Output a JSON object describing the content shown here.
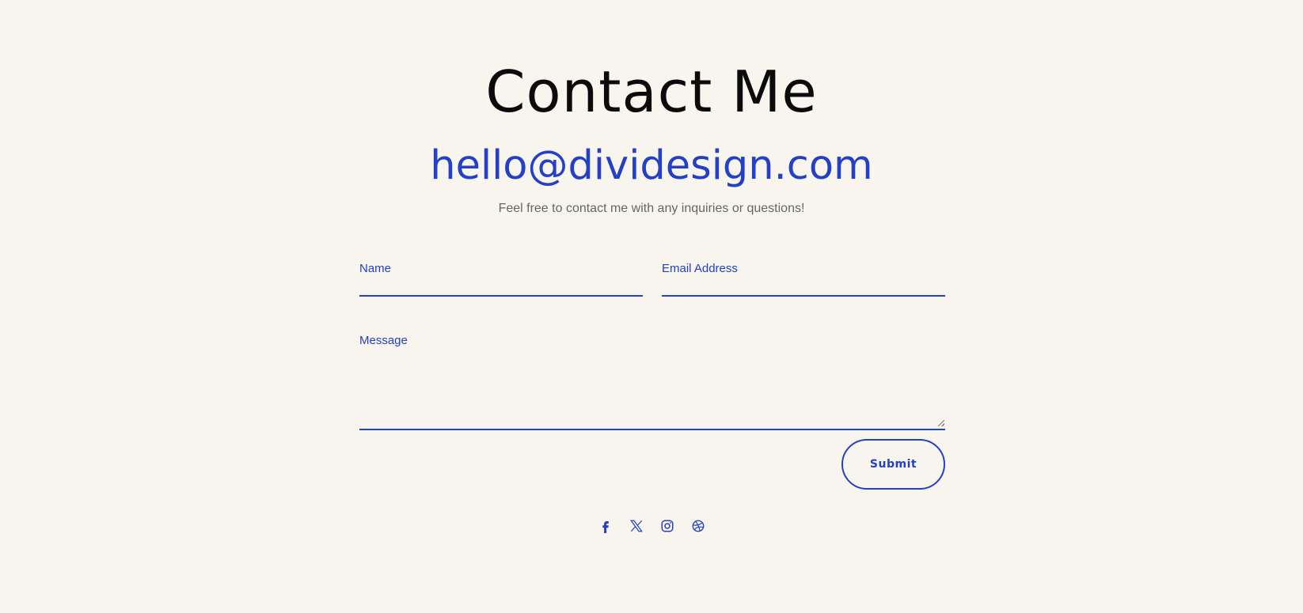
{
  "page": {
    "title": "Contact Me",
    "email": "hello@dividesign.com",
    "intro": "Feel free to contact me with any inquiries or questions!"
  },
  "form": {
    "name_label": "Name",
    "email_label": "Email Address",
    "message_label": "Message",
    "submit_label": "Submit"
  },
  "social": [
    {
      "icon": "facebook-icon"
    },
    {
      "icon": "x-twitter-icon"
    },
    {
      "icon": "instagram-icon"
    },
    {
      "icon": "dribbble-icon"
    }
  ],
  "colors": {
    "background": "#f8f5ee",
    "accent": "#2340c6",
    "heading": "#0b0b0b",
    "body_text": "#666666"
  }
}
